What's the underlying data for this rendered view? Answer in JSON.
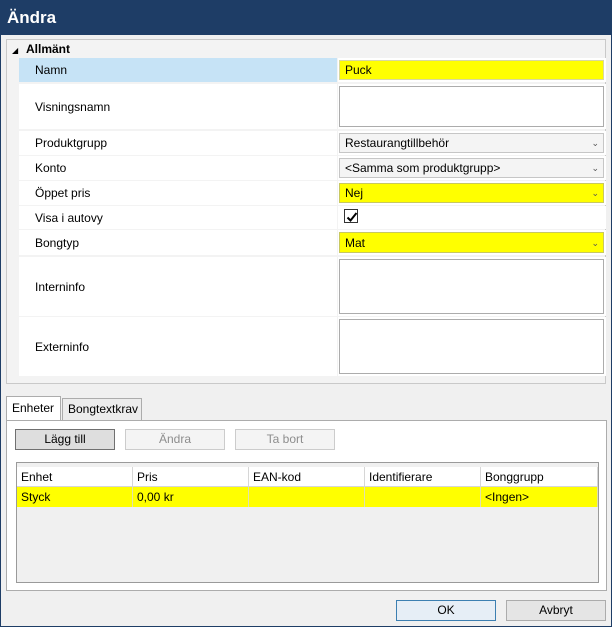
{
  "window": {
    "title": "Ändra"
  },
  "properties": {
    "group": "Allmänt",
    "rows": [
      {
        "label": "Namn",
        "value": "Puck"
      },
      {
        "label": "Visningsnamn",
        "value": ""
      },
      {
        "label": "Produktgrupp",
        "value": "Restaurangtillbehör"
      },
      {
        "label": "Konto",
        "value": "<Samma som produktgrupp>"
      },
      {
        "label": "Öppet pris",
        "value": "Nej"
      },
      {
        "label": "Visa i autovy",
        "checked": true
      },
      {
        "label": "Bongtyp",
        "value": "Mat"
      },
      {
        "label": "Interninfo",
        "value": ""
      },
      {
        "label": "Externinfo",
        "value": ""
      }
    ]
  },
  "tabs": [
    {
      "label": "Enheter",
      "active": true
    },
    {
      "label": "Bongtextkrav",
      "active": false
    }
  ],
  "toolbar": {
    "add": "Lägg till",
    "edit": "Ändra",
    "remove": "Ta bort"
  },
  "units_table": {
    "columns": [
      "Enhet",
      "Pris",
      "EAN-kod",
      "Identifierare",
      "Bonggrupp"
    ],
    "rows": [
      [
        "Styck",
        "0,00 kr",
        "",
        "",
        "<Ingen>"
      ]
    ]
  },
  "footer": {
    "ok": "OK",
    "cancel": "Avbryt"
  },
  "colors": {
    "title_bar": "#1e3d66",
    "highlight": "#ffff00",
    "selected_row": "#c6e3f6"
  },
  "icons": {
    "expander": "triangle-down-icon",
    "dropdown": "chevron-down-icon",
    "check": "check-icon"
  }
}
